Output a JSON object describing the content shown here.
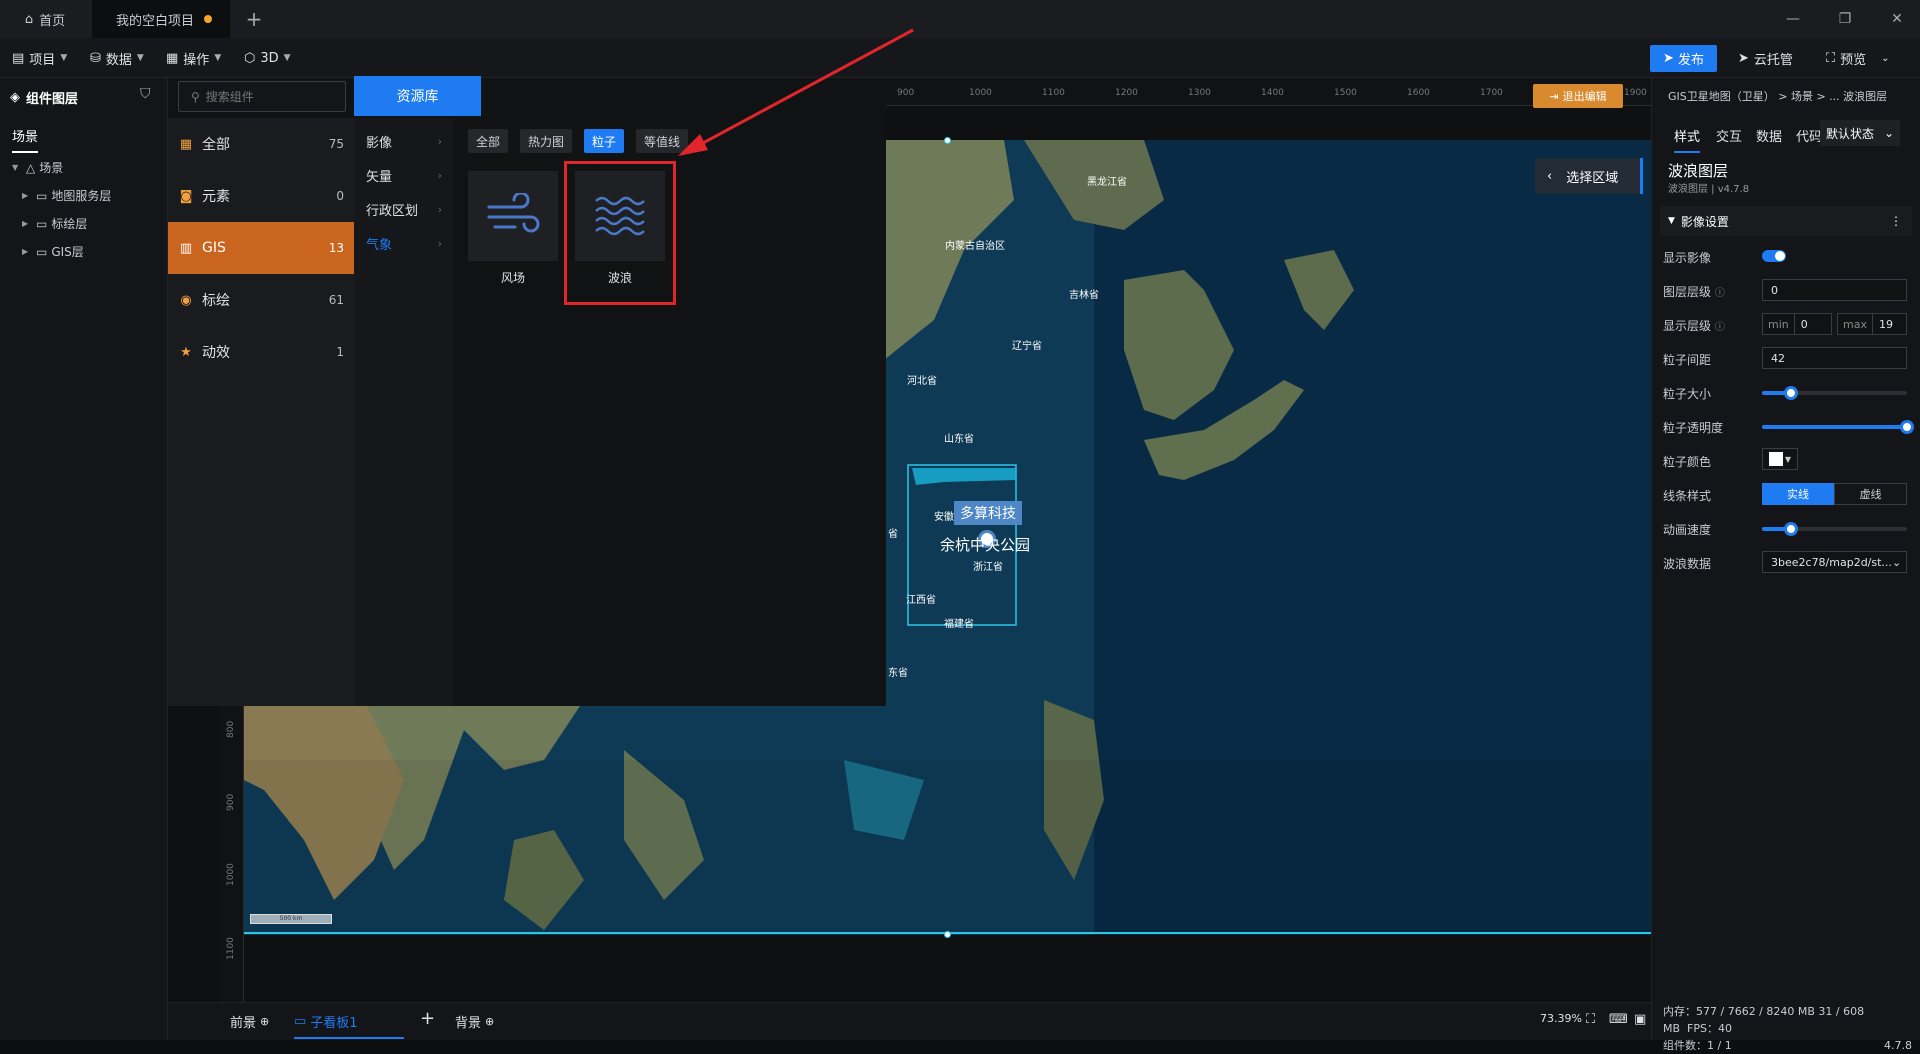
{
  "tabs": {
    "home": "首页",
    "project": "我的空白项目",
    "add": "+"
  },
  "toolbar": {
    "project": "项目",
    "data": "数据",
    "operate": "操作",
    "three_d": "3D",
    "publish": "发布",
    "cloud": "云托管",
    "preview": "预览"
  },
  "left_panel": {
    "title": "组件图层",
    "tab": "场景",
    "tree": [
      "场景",
      "地图服务层",
      "标绘层",
      "GIS层"
    ]
  },
  "library": {
    "search_placeholder": "搜索组件",
    "resource_tab": "资源库",
    "categories": [
      {
        "label": "全部",
        "count": "75"
      },
      {
        "label": "元素",
        "count": "0"
      },
      {
        "label": "GIS",
        "count": "13"
      },
      {
        "label": "标绘",
        "count": "61"
      },
      {
        "label": "动效",
        "count": "1"
      }
    ],
    "subcategories": [
      "影像",
      "矢量",
      "行政区划",
      "气象"
    ],
    "filters": [
      "全部",
      "热力图",
      "粒子",
      "等值线"
    ],
    "cards": [
      "风场",
      "波浪"
    ]
  },
  "canvas": {
    "ruler_top": [
      "900",
      "1000",
      "1100",
      "1200",
      "1300",
      "1400",
      "1500",
      "1600",
      "1700",
      "1900"
    ],
    "ruler_left": [
      "800",
      "900",
      "1000",
      "1100"
    ],
    "exit_edit": "退出编辑",
    "select_region": "选择区域",
    "map_labels": {
      "heilongjiang": "黑龙江省",
      "neimenggu": "内蒙古自治区",
      "jilin": "吉林省",
      "liaoning": "辽宁省",
      "hebei": "河北省",
      "shandong": "山东省",
      "anhui": "安徽",
      "zhejiang": "浙江省",
      "jiangxi": "江西省",
      "fujian": "福建省",
      "guangdong": "东省",
      "hu": "省",
      "marker_top": "多算科技",
      "marker_bottom": "余杭中央公园",
      "scale": "500 km"
    }
  },
  "bottom": {
    "front": "前景",
    "sub_board": "子看板1",
    "add": "+",
    "back": "背景",
    "zoom": "73.39%"
  },
  "right_panel": {
    "breadcrumb": "GIS卫星地图（卫星） > 场景 > ... 波浪图层",
    "tabs": [
      "样式",
      "交互",
      "数据",
      "代码"
    ],
    "state": "默认状态",
    "layer_name": "波浪图层",
    "layer_version": "波浪图层 | v4.7.8",
    "section": "影像设置",
    "props": {
      "show_image": "显示影像",
      "layer_level": "图层层级",
      "layer_level_value": "0",
      "show_level": "显示层级",
      "min_label": "min",
      "min_value": "0",
      "max_label": "max",
      "max_value": "19",
      "particle_spacing": "粒子间距",
      "particle_spacing_value": "42",
      "particle_size": "粒子大小",
      "particle_opacity": "粒子透明度",
      "particle_color": "粒子颜色",
      "line_style": "线条样式",
      "solid": "实线",
      "dashed": "虚线",
      "anim_speed": "动画速度",
      "wave_data": "波浪数据",
      "wave_data_value": "3bee2c78/map2d/st..."
    },
    "sliders": {
      "particle_size": 0.2,
      "particle_opacity": 1.0,
      "anim_speed": 0.2
    }
  },
  "status": {
    "memory": "内存：577 / 7662 / 8240 MB  31 / 608 MB",
    "fps": "FPS：40",
    "components": "组件数：1 / 1",
    "version": "4.7.8"
  },
  "colors": {
    "accent": "#1e7bf2",
    "gis_active": "#c9651f",
    "highlight": "#e0262b"
  }
}
